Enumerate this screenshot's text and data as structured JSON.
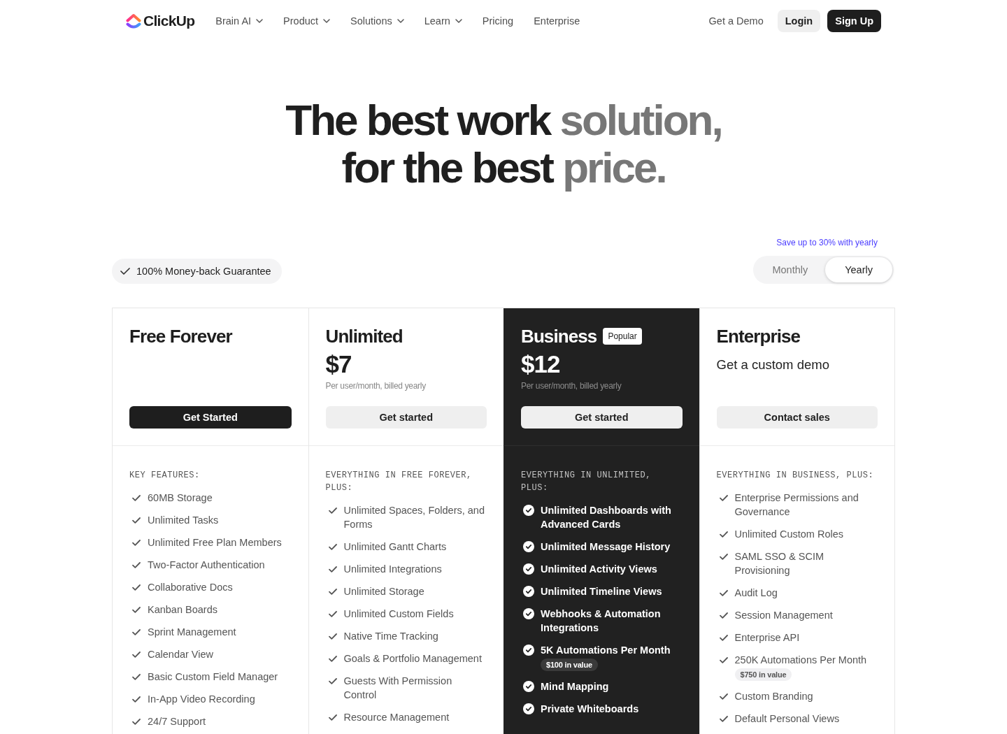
{
  "nav": {
    "logo": "ClickUp",
    "items": [
      {
        "label": "Brain AI",
        "dropdown": true
      },
      {
        "label": "Product",
        "dropdown": true
      },
      {
        "label": "Solutions",
        "dropdown": true
      },
      {
        "label": "Learn",
        "dropdown": true
      },
      {
        "label": "Pricing",
        "dropdown": false
      },
      {
        "label": "Enterprise",
        "dropdown": false
      }
    ],
    "demo_link": "Get a Demo",
    "login": "Login",
    "signup": "Sign Up"
  },
  "hero": {
    "lines": [
      {
        "parts": [
          {
            "text": "The best work",
            "kind": "strong"
          },
          {
            "text": "solution,",
            "kind": "muted"
          }
        ]
      },
      {
        "parts": [
          {
            "text": "for the best",
            "kind": "strong"
          },
          {
            "text": "price.",
            "kind": "muted"
          }
        ]
      }
    ]
  },
  "guarantee": "100% Money-back Guarantee",
  "billing": {
    "note": "Save up to 30% with yearly",
    "options": [
      {
        "label": "Monthly",
        "selected": false
      },
      {
        "label": "Yearly",
        "selected": true
      }
    ]
  },
  "plans": [
    {
      "name": "Free Forever",
      "kind": "light",
      "button": {
        "label": "Get Started",
        "kind": "primary"
      },
      "features_title": "KEY FEATURES:",
      "features": [
        {
          "text": "60MB Storage"
        },
        {
          "text": "Unlimited Tasks"
        },
        {
          "text": "Unlimited Free Plan Members"
        },
        {
          "text": "Two-Factor Authentication"
        },
        {
          "text": "Collaborative Docs"
        },
        {
          "text": "Kanban Boards"
        },
        {
          "text": "Sprint Management"
        },
        {
          "text": "Calendar View"
        },
        {
          "text": "Basic Custom Field Manager"
        },
        {
          "text": "In-App Video Recording"
        },
        {
          "text": "24/7 Support"
        }
      ]
    },
    {
      "name": "Unlimited",
      "kind": "light",
      "price": "$7",
      "price_note": "Per user/month, billed yearly",
      "button": {
        "label": "Get started",
        "kind": "secondary"
      },
      "features_title": "EVERYTHING IN FREE FOREVER, PLUS:",
      "features": [
        {
          "text": "Unlimited Spaces, Folders, and Forms"
        },
        {
          "text": "Unlimited Gantt Charts"
        },
        {
          "text": "Unlimited Integrations"
        },
        {
          "text": "Unlimited Storage"
        },
        {
          "text": "Unlimited Custom Fields"
        },
        {
          "text": "Native Time Tracking"
        },
        {
          "text": "Goals & Portfolio Management"
        },
        {
          "text": "Guests With Permission Control"
        },
        {
          "text": "Resource Management"
        }
      ]
    },
    {
      "name": "Business",
      "kind": "dark",
      "badge": "Popular",
      "price": "$12",
      "price_note": "Per user/month, billed yearly",
      "button": {
        "label": "Get started",
        "kind": "secondary"
      },
      "features_title": "EVERYTHING IN UNLIMITED, PLUS:",
      "features": [
        {
          "text": "Unlimited Dashboards with Advanced Cards"
        },
        {
          "text": "Unlimited Message History"
        },
        {
          "text": "Unlimited Activity Views"
        },
        {
          "text": "Unlimited Timeline Views"
        },
        {
          "text": "Webhooks & Automation Integrations"
        },
        {
          "text": "5K Automations Per Month",
          "value_badge": "$100 in value"
        },
        {
          "text": "Mind Mapping"
        },
        {
          "text": "Private Whiteboards"
        }
      ]
    },
    {
      "name": "Enterprise",
      "kind": "light",
      "subtitle": "Get a custom demo",
      "button": {
        "label": "Contact sales",
        "kind": "secondary"
      },
      "features_title": "EVERYTHING IN BUSINESS, PLUS:",
      "features": [
        {
          "text": "Enterprise Permissions and Governance"
        },
        {
          "text": "Unlimited Custom Roles"
        },
        {
          "text": "SAML SSO & SCIM Provisioning"
        },
        {
          "text": "Audit Log"
        },
        {
          "text": "Session Management"
        },
        {
          "text": "Enterprise API"
        },
        {
          "text": "250K Automations Per Month",
          "value_badge": "$750 in value"
        },
        {
          "text": "Custom Branding"
        },
        {
          "text": "Default Personal Views"
        }
      ]
    }
  ]
}
